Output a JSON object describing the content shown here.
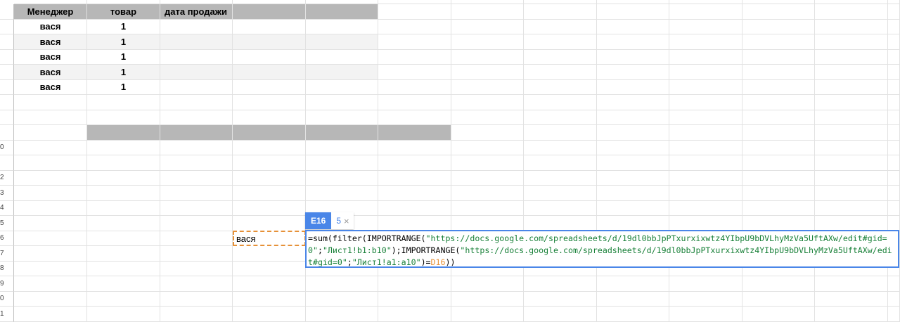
{
  "sheet": {
    "row_numbers": [
      "",
      "",
      "",
      "",
      "",
      "",
      "",
      "",
      "",
      "0",
      "",
      "2",
      "3",
      "4",
      "5",
      "6",
      "7",
      "8",
      "9",
      "0",
      "1"
    ],
    "headers": {
      "manager": "Менеджер",
      "product": "товар",
      "sale_date": "дата продажи"
    },
    "rows": [
      {
        "manager": "вася",
        "product": "1"
      },
      {
        "manager": "вася",
        "product": "1"
      },
      {
        "manager": "вася",
        "product": "1"
      },
      {
        "manager": "вася",
        "product": "1"
      },
      {
        "manager": "вася",
        "product": "1"
      }
    ],
    "colors": {
      "header_bg": "#b7b7b7",
      "stripe_bg": "#f3f3f3",
      "selection_border": "#e69138",
      "formula_border": "#4a86e8",
      "string_token": "#188038",
      "cell_ref_token": "#e69138"
    }
  },
  "editor": {
    "selected_cell_value": "вася",
    "ref_chip_label": "E16",
    "ref_chip_value": "5",
    "ref_chip_close": "×",
    "formula_tokens": [
      {
        "t": "=sum(filter(IMPORTRANGE(",
        "k": "plain"
      },
      {
        "t": "\"https://docs.google.com/spreadsheets/d/19dl0bbJpPTxurxixwtz4YIbpU9bDVLhyMzVa5UftAXw/edit#gid=0\"",
        "k": "str"
      },
      {
        "t": ";",
        "k": "plain"
      },
      {
        "t": "\"Лист1!b1:b10\"",
        "k": "str"
      },
      {
        "t": ");IMPORTRANGE(",
        "k": "plain"
      },
      {
        "t": "\"https://docs.google.com/spreadsheets/d/19dl0bbJpPTxurxixwtz4YIbpU9bDVLhyMzVa5UftAXw/edit#gid=0\"",
        "k": "str"
      },
      {
        "t": ";",
        "k": "plain"
      },
      {
        "t": "\"Лист1!a1:a10\"",
        "k": "str"
      },
      {
        "t": ")=",
        "k": "plain"
      },
      {
        "t": "D16",
        "k": "ref"
      },
      {
        "t": "))",
        "k": "plain"
      }
    ]
  }
}
